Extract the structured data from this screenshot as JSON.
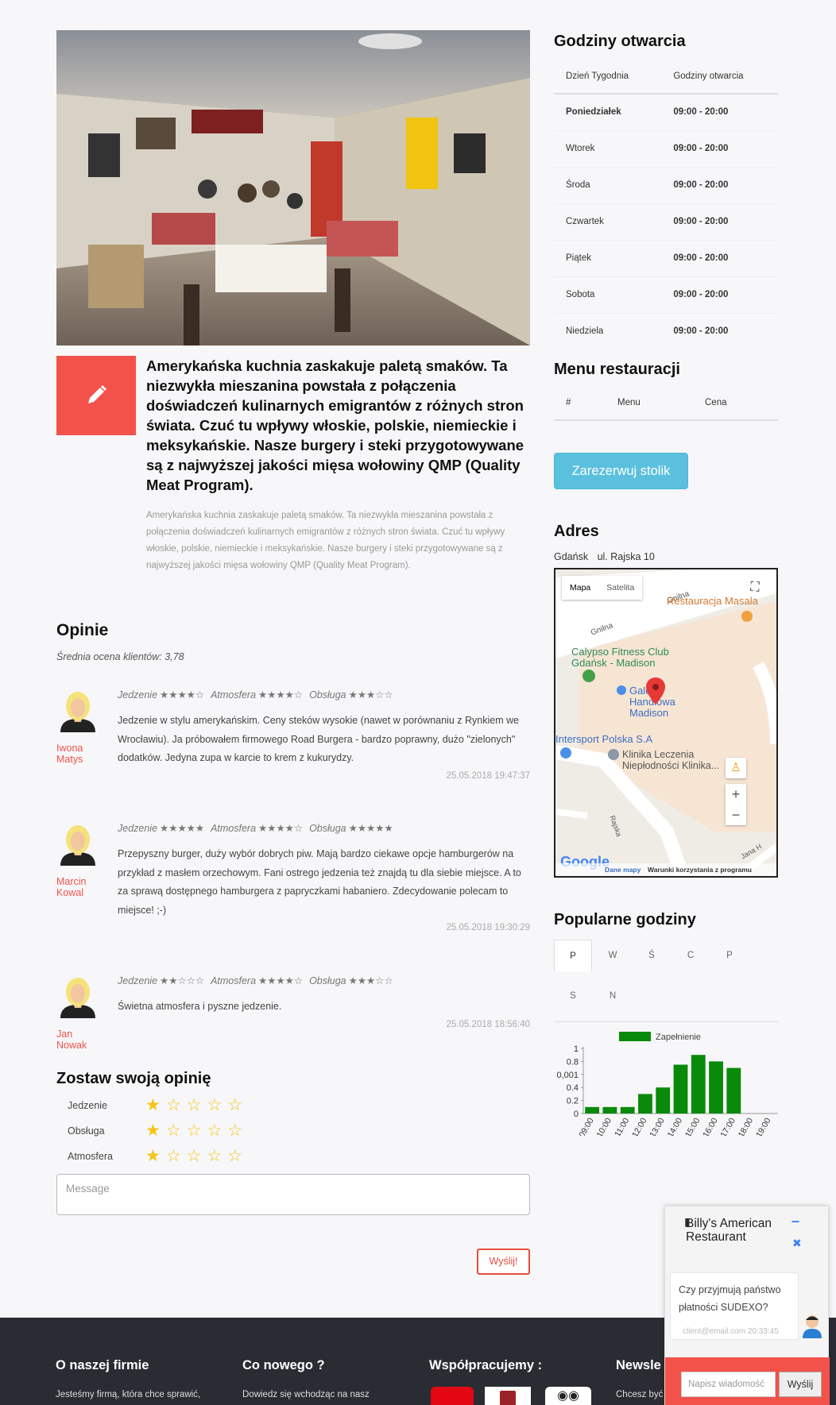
{
  "intro": {
    "heading": "Amerykańska kuchnia zaskakuje paletą smaków. Ta niezwykła mieszanina powstała z połączenia doświadczeń kulinarnych emigrantów z różnych stron świata. Czuć tu wpływy włoskie, polskie, niemieckie i meksykańskie. Nasze burgery i steki przygotowywane są z najwyższej jakości mięsa wołowiny QMP (Quality Meat Program).",
    "body": "Amerykańska kuchnia zaskakuje paletą smaków. Ta niezwykła mieszanina powstała z połączenia doświadczeń kulinarnych emigrantów z różnych stron świata. Czuć tu wpływy włoskie, polskie, niemieckie i meksykańskie. Nasze burgery i steki przygotowywane są z najwyższej jakości mięsa wołowiny QMP (Quality Meat Program)."
  },
  "reviews_section": {
    "title": "Opinie",
    "average": "Średnia ocena klientów: 3,78",
    "labels": {
      "food": "Jedzenie",
      "atmosphere": "Atmosfera",
      "service": "Obsługa"
    },
    "items": [
      {
        "first": "Iwona",
        "last": "Matys",
        "food": 4,
        "atmosphere": 4,
        "service": 3,
        "text": "Jedzenie w stylu amerykańskim. Ceny steków wysokie (nawet w porównaniu z Rynkiem we Wrocławiu). Ja próbowałem firmowego Road Burgera - bardzo poprawny, dużo \"zielonych\" dodatków. Jedyna zupa w karcie to krem z kukurydzy.",
        "date": "25.05.2018 19:47:37"
      },
      {
        "first": "Marcin",
        "last": "Kowal",
        "food": 5,
        "atmosphere": 4,
        "service": 5,
        "text": "Przepyszny burger, duży wybór dobrych piw. Mają bardzo ciekawe opcje hamburgerów na przykład z masłem orzechowym. Fani ostrego jedzenia też znajdą tu dla siebie miejsce. A to za sprawą dostępnego hamburgera z papryczkami habaniero. Zdecydowanie polecam to miejsce! ;-)",
        "date": "25.05.2018 19:30:29"
      },
      {
        "first": "Jan",
        "last": "Nowak",
        "food": 2,
        "atmosphere": 4,
        "service": 3,
        "text": "Świetna atmosfera i pyszne jedzenie.",
        "date": "25.05.2018 18:56:40"
      }
    ]
  },
  "leave_review": {
    "title": "Zostaw swoją opinię",
    "rows": [
      "Jedzenie",
      "Obsługa",
      "Atmosfera"
    ],
    "message_placeholder": "Message",
    "send_label": "Wyślij!"
  },
  "hours": {
    "title": "Godziny otwarcia",
    "col_day": "Dzień Tygodnia",
    "col_hours": "Godziny otwarcia",
    "rows": [
      {
        "day": "Poniedziałek",
        "hours": "09:00 - 20:00"
      },
      {
        "day": "Wtorek",
        "hours": "09:00 - 20:00"
      },
      {
        "day": "Środa",
        "hours": "09:00 - 20:00"
      },
      {
        "day": "Czwartek",
        "hours": "09:00 - 20:00"
      },
      {
        "day": "Piątek",
        "hours": "09:00 - 20:00"
      },
      {
        "day": "Sobota",
        "hours": "09:00 - 20:00"
      },
      {
        "day": "Niedziela",
        "hours": "09:00 - 20:00"
      }
    ]
  },
  "menu": {
    "title": "Menu restauracji",
    "col_num": "#",
    "col_menu": "Menu",
    "col_price": "Cena",
    "reserve_label": "Zarezerwuj stolik"
  },
  "address": {
    "title": "Adres",
    "city": "Gdańsk",
    "street": "ul. Rajska 10"
  },
  "map": {
    "tab_map": "Mapa",
    "tab_satellite": "Satelita",
    "place_masala": "Restauracja Masala",
    "place_calypso": "Calypso Fitness Club Gdańsk - Madison",
    "place_madison": "Galeria Handlowa Madison",
    "place_intersport": "Intersport Polska S.A",
    "place_clinic": "Klinika Leczenia Niepłodności Klinika...",
    "street_gnilna": "Gnilna",
    "street_gn2": "Gnilna",
    "street_rajska": "Rajska",
    "street_jana": "Jana H",
    "logo": "Google",
    "data_label": "Dane mapy",
    "terms": "Warunki korzystania z programu",
    "zoom_in": "+",
    "zoom_out": "−",
    "colors": {
      "pin": "#e53935",
      "green_pin": "#43a047",
      "blue_pin": "#4a8fe7",
      "orange_pin": "#f0a040"
    }
  },
  "popular": {
    "title": "Popularne godziny",
    "tabs": [
      "P",
      "W",
      "Ś",
      "C",
      "P",
      "S",
      "N"
    ],
    "active_tab": 0
  },
  "chart_data": {
    "type": "bar",
    "legend": "Zapełnienie",
    "categories": [
      "09:00",
      "10:00",
      "11:00",
      "12:00",
      "13:00",
      "14:00",
      "15:00",
      "16:00",
      "17:00",
      "18:00",
      "19:00"
    ],
    "values": [
      0.1,
      0.1,
      0.1,
      0.3,
      0.4,
      0.75,
      0.9,
      0.8,
      0.7,
      0,
      0
    ],
    "yticks": [
      "0",
      "0.2",
      "0.4",
      "0,001",
      "0.8",
      "1"
    ],
    "ylim": [
      0,
      1
    ],
    "color": "#0a8a0a"
  },
  "footer": {
    "col1_title": "O naszej firmie",
    "col1_text": "Jesteśmy firmą, która chce sprawić,",
    "col2_title": "Co nowego ?",
    "col2_text": "Dowiedz się wchodząc na nasz",
    "col3_title": "Współpracujemy :",
    "col4_title": "Newsle",
    "col4_text": "Chcesz być"
  },
  "chat": {
    "title": "Billy's American Restaurant",
    "message": "Czy przyjmują państwo płatności SUDEXO?",
    "meta": "client@email.com 20:33:45",
    "input_placeholder": "Napisz wiadomość",
    "send_label": "Wyślij",
    "minimize": "–",
    "close": "✖"
  },
  "colors": {
    "accent": "#f2524a",
    "reserve": "#5bc0de",
    "star": "#f5c518",
    "footer_bg": "#2a2c33"
  }
}
